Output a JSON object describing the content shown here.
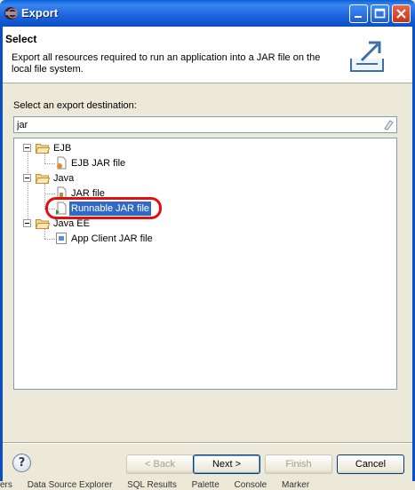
{
  "window": {
    "title": "Export"
  },
  "header": {
    "title": "Select",
    "description": "Export all resources required to run an application into a JAR file on the local file system."
  },
  "destination": {
    "label": "Select an export destination:",
    "filter_value": "jar"
  },
  "tree": {
    "groups": [
      {
        "label": "EJB",
        "children": [
          "EJB JAR file"
        ]
      },
      {
        "label": "Java",
        "children": [
          "JAR file",
          "Runnable JAR file"
        ]
      },
      {
        "label": "Java EE",
        "children": [
          "App Client JAR file"
        ]
      }
    ],
    "selected_item": "Runnable JAR file"
  },
  "buttons": {
    "help": "?",
    "back": "< Back",
    "next": "Next >",
    "finish": "Finish",
    "cancel": "Cancel"
  },
  "taskbar": {
    "items": [
      "ers",
      "Data Source Explorer",
      "SQL Results",
      "Palette",
      "Console",
      "Marker"
    ]
  },
  "colors": {
    "titlebar": "#0a5fd8",
    "selection": "#316ac5",
    "highlight_ring": "#e01010"
  }
}
